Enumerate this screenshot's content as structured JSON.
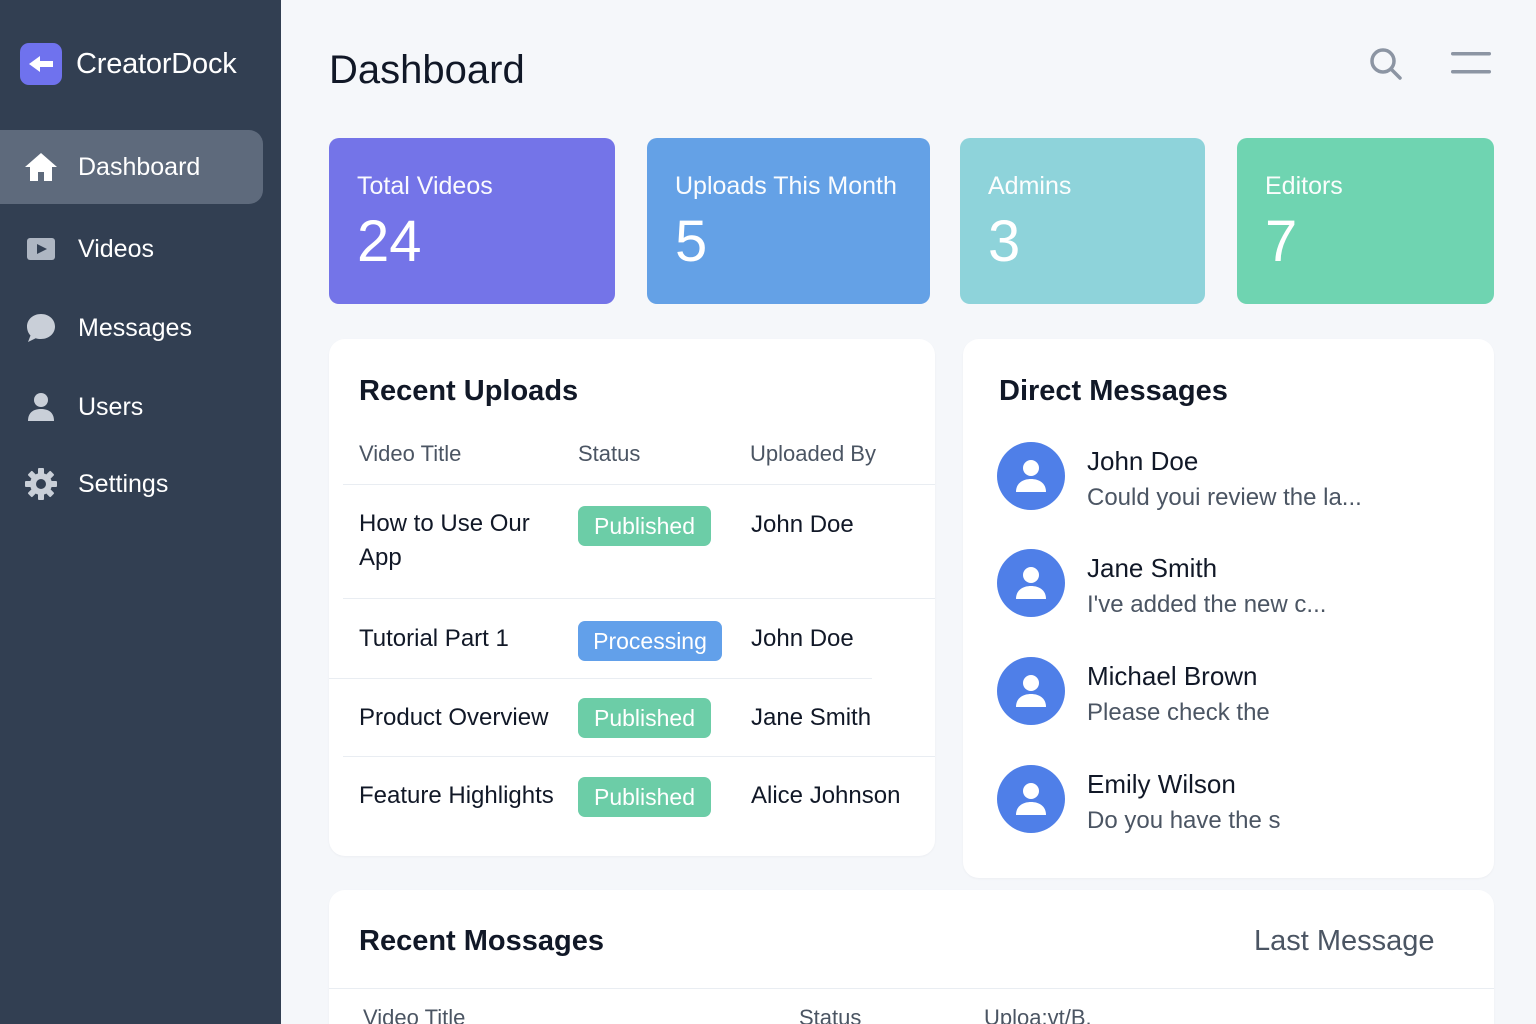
{
  "app": {
    "name": "CreatorDock"
  },
  "sidebar": {
    "items": [
      {
        "label": "Dashboard",
        "icon": "home-icon",
        "active": true
      },
      {
        "label": "Videos",
        "icon": "video-icon",
        "active": false
      },
      {
        "label": "Messages",
        "icon": "chat-bubble-icon",
        "active": false
      },
      {
        "label": "Users",
        "icon": "user-icon",
        "active": false
      },
      {
        "label": "Settings",
        "icon": "gear-icon",
        "active": false
      }
    ]
  },
  "header": {
    "title": "Dashboard",
    "search_icon": "search-icon",
    "menu_icon": "menu-icon"
  },
  "stats": [
    {
      "label": "Total Videos",
      "value": "24",
      "color": "#7474e8"
    },
    {
      "label": "Uploads This Month",
      "value": "5",
      "color": "#64a1e6"
    },
    {
      "label": "Admins",
      "value": "3",
      "color": "#8ed3da"
    },
    {
      "label": "Editors",
      "value": "7",
      "color": "#6fd4b1"
    }
  ],
  "recent_uploads": {
    "title": "Recent Uploads",
    "columns": [
      "Video Title",
      "Status",
      "Uploaded By"
    ],
    "rows": [
      {
        "title": "How to Use Our App",
        "status": "Published",
        "uploaded_by": "John Doe"
      },
      {
        "title": "Tutorial Part 1",
        "status": "Processing",
        "uploaded_by": "John Doe"
      },
      {
        "title": "Product Overview",
        "status": "Published",
        "uploaded_by": "Jane Smith"
      },
      {
        "title": "Feature Highlights",
        "status": "Published",
        "uploaded_by": "Alice Johnson"
      }
    ],
    "status_colors": {
      "Published": "#6ccda7",
      "Processing": "#62a0ea"
    }
  },
  "direct_messages": {
    "title": "Direct Messages",
    "items": [
      {
        "name": "John Doe",
        "preview": "Could youi review the la..."
      },
      {
        "name": "Jane Smith",
        "preview": "I've added the new c..."
      },
      {
        "name": "Michael Brown",
        "preview": "Please check the"
      },
      {
        "name": "Emily Wilson",
        "preview": "Do you have the s"
      }
    ]
  },
  "recent_messages": {
    "title": "Recent Mossages",
    "right_label": "Last Message",
    "columns": [
      "Video Title",
      "Status",
      "Uploa:vt/B."
    ]
  }
}
